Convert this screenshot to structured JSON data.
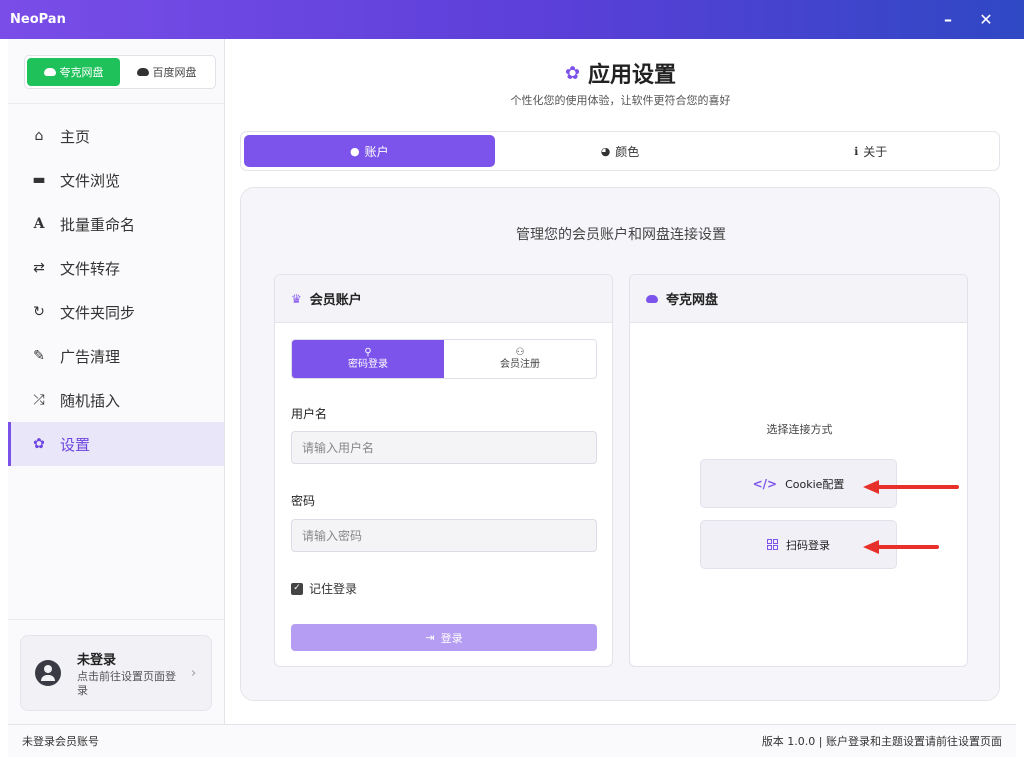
{
  "window": {
    "title": "NeoPan",
    "minimize": "–",
    "close": "✕"
  },
  "sidebar": {
    "drives": [
      {
        "label": "夸克网盘",
        "icon": "cloud-icon",
        "active": true
      },
      {
        "label": "百度网盘",
        "icon": "cloud-icon",
        "active": false
      }
    ],
    "items": [
      {
        "label": "主页",
        "icon": "⌂"
      },
      {
        "label": "文件浏览",
        "icon": "▬"
      },
      {
        "label": "批量重命名",
        "icon": "A"
      },
      {
        "label": "文件转存",
        "icon": "⇄"
      },
      {
        "label": "文件夹同步",
        "icon": "↻"
      },
      {
        "label": "广告清理",
        "icon": "✎"
      },
      {
        "label": "随机插入",
        "icon": "⤮"
      },
      {
        "label": "设置",
        "icon": "✿"
      }
    ],
    "user": {
      "name": "未登录",
      "hint": "点击前往设置页面登录",
      "chevron": "›"
    }
  },
  "main": {
    "title": "应用设置",
    "title_icon": "✿",
    "subtitle": "个性化您的使用体验，让软件更符合您的喜好",
    "tabs": [
      {
        "label": "账户",
        "icon": "●"
      },
      {
        "label": "颜色",
        "icon": "◕"
      },
      {
        "label": "关于",
        "icon": "ℹ"
      }
    ],
    "description": "管理您的会员账户和网盘连接设置",
    "member_panel": {
      "title": "会员账户",
      "title_icon": "♛",
      "subtabs": [
        {
          "label": "密码登录",
          "icon": "⚲"
        },
        {
          "label": "会员注册",
          "icon": "⚇"
        }
      ],
      "username_label": "用户名",
      "username_placeholder": "请输入用户名",
      "password_label": "密码",
      "password_placeholder": "请输入密码",
      "remember_label": "记住登录",
      "remember_check": "✓",
      "login_label": "登录",
      "login_icon": "⇥"
    },
    "cloud_panel": {
      "title": "夸克网盘",
      "choose_label": "选择连接方式",
      "cookie_label": "Cookie配置",
      "cookie_icon": "</>",
      "qr_label": "扫码登录"
    }
  },
  "status": {
    "left": "未登录会员账号",
    "right": "版本 1.0.0 | 账户登录和主题设置请前往设置页面"
  },
  "colors": {
    "accent": "#7c54eb",
    "drive_active": "#1fc15b",
    "annotation_arrow": "#e8302a"
  }
}
